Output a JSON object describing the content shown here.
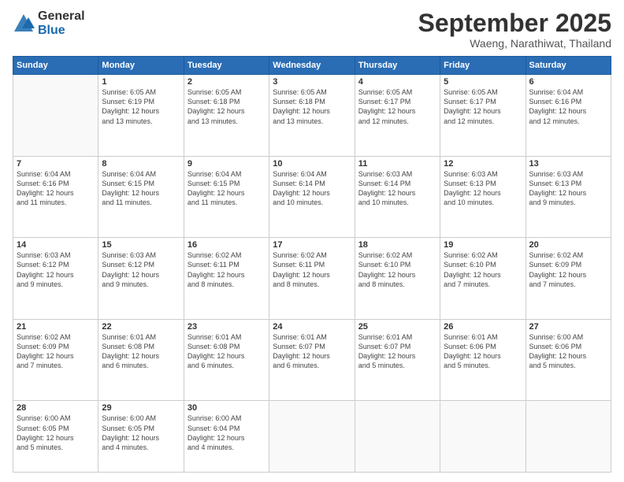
{
  "header": {
    "logo_general": "General",
    "logo_blue": "Blue",
    "month": "September 2025",
    "location": "Waeng, Narathiwat, Thailand"
  },
  "weekdays": [
    "Sunday",
    "Monday",
    "Tuesday",
    "Wednesday",
    "Thursday",
    "Friday",
    "Saturday"
  ],
  "weeks": [
    [
      {
        "day": "",
        "info": ""
      },
      {
        "day": "1",
        "info": "Sunrise: 6:05 AM\nSunset: 6:19 PM\nDaylight: 12 hours\nand 13 minutes."
      },
      {
        "day": "2",
        "info": "Sunrise: 6:05 AM\nSunset: 6:18 PM\nDaylight: 12 hours\nand 13 minutes."
      },
      {
        "day": "3",
        "info": "Sunrise: 6:05 AM\nSunset: 6:18 PM\nDaylight: 12 hours\nand 13 minutes."
      },
      {
        "day": "4",
        "info": "Sunrise: 6:05 AM\nSunset: 6:17 PM\nDaylight: 12 hours\nand 12 minutes."
      },
      {
        "day": "5",
        "info": "Sunrise: 6:05 AM\nSunset: 6:17 PM\nDaylight: 12 hours\nand 12 minutes."
      },
      {
        "day": "6",
        "info": "Sunrise: 6:04 AM\nSunset: 6:16 PM\nDaylight: 12 hours\nand 12 minutes."
      }
    ],
    [
      {
        "day": "7",
        "info": "Sunrise: 6:04 AM\nSunset: 6:16 PM\nDaylight: 12 hours\nand 11 minutes."
      },
      {
        "day": "8",
        "info": "Sunrise: 6:04 AM\nSunset: 6:15 PM\nDaylight: 12 hours\nand 11 minutes."
      },
      {
        "day": "9",
        "info": "Sunrise: 6:04 AM\nSunset: 6:15 PM\nDaylight: 12 hours\nand 11 minutes."
      },
      {
        "day": "10",
        "info": "Sunrise: 6:04 AM\nSunset: 6:14 PM\nDaylight: 12 hours\nand 10 minutes."
      },
      {
        "day": "11",
        "info": "Sunrise: 6:03 AM\nSunset: 6:14 PM\nDaylight: 12 hours\nand 10 minutes."
      },
      {
        "day": "12",
        "info": "Sunrise: 6:03 AM\nSunset: 6:13 PM\nDaylight: 12 hours\nand 10 minutes."
      },
      {
        "day": "13",
        "info": "Sunrise: 6:03 AM\nSunset: 6:13 PM\nDaylight: 12 hours\nand 9 minutes."
      }
    ],
    [
      {
        "day": "14",
        "info": "Sunrise: 6:03 AM\nSunset: 6:12 PM\nDaylight: 12 hours\nand 9 minutes."
      },
      {
        "day": "15",
        "info": "Sunrise: 6:03 AM\nSunset: 6:12 PM\nDaylight: 12 hours\nand 9 minutes."
      },
      {
        "day": "16",
        "info": "Sunrise: 6:02 AM\nSunset: 6:11 PM\nDaylight: 12 hours\nand 8 minutes."
      },
      {
        "day": "17",
        "info": "Sunrise: 6:02 AM\nSunset: 6:11 PM\nDaylight: 12 hours\nand 8 minutes."
      },
      {
        "day": "18",
        "info": "Sunrise: 6:02 AM\nSunset: 6:10 PM\nDaylight: 12 hours\nand 8 minutes."
      },
      {
        "day": "19",
        "info": "Sunrise: 6:02 AM\nSunset: 6:10 PM\nDaylight: 12 hours\nand 7 minutes."
      },
      {
        "day": "20",
        "info": "Sunrise: 6:02 AM\nSunset: 6:09 PM\nDaylight: 12 hours\nand 7 minutes."
      }
    ],
    [
      {
        "day": "21",
        "info": "Sunrise: 6:02 AM\nSunset: 6:09 PM\nDaylight: 12 hours\nand 7 minutes."
      },
      {
        "day": "22",
        "info": "Sunrise: 6:01 AM\nSunset: 6:08 PM\nDaylight: 12 hours\nand 6 minutes."
      },
      {
        "day": "23",
        "info": "Sunrise: 6:01 AM\nSunset: 6:08 PM\nDaylight: 12 hours\nand 6 minutes."
      },
      {
        "day": "24",
        "info": "Sunrise: 6:01 AM\nSunset: 6:07 PM\nDaylight: 12 hours\nand 6 minutes."
      },
      {
        "day": "25",
        "info": "Sunrise: 6:01 AM\nSunset: 6:07 PM\nDaylight: 12 hours\nand 5 minutes."
      },
      {
        "day": "26",
        "info": "Sunrise: 6:01 AM\nSunset: 6:06 PM\nDaylight: 12 hours\nand 5 minutes."
      },
      {
        "day": "27",
        "info": "Sunrise: 6:00 AM\nSunset: 6:06 PM\nDaylight: 12 hours\nand 5 minutes."
      }
    ],
    [
      {
        "day": "28",
        "info": "Sunrise: 6:00 AM\nSunset: 6:05 PM\nDaylight: 12 hours\nand 5 minutes."
      },
      {
        "day": "29",
        "info": "Sunrise: 6:00 AM\nSunset: 6:05 PM\nDaylight: 12 hours\nand 4 minutes."
      },
      {
        "day": "30",
        "info": "Sunrise: 6:00 AM\nSunset: 6:04 PM\nDaylight: 12 hours\nand 4 minutes."
      },
      {
        "day": "",
        "info": ""
      },
      {
        "day": "",
        "info": ""
      },
      {
        "day": "",
        "info": ""
      },
      {
        "day": "",
        "info": ""
      }
    ]
  ]
}
